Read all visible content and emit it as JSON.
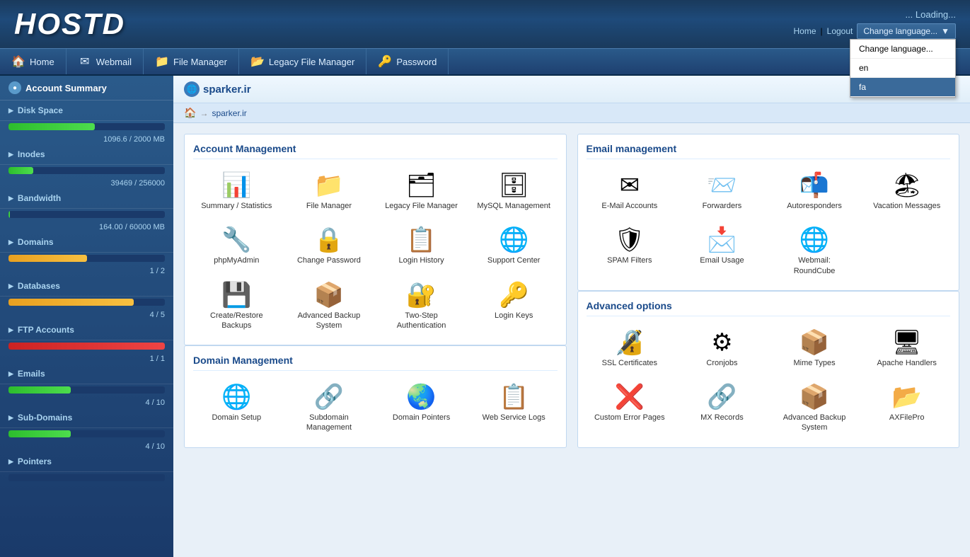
{
  "header": {
    "logo": "HOSTD",
    "loading": "... Loading...",
    "links": {
      "home": "Home",
      "pipe": "|",
      "logout": "Logout"
    },
    "language": {
      "button_label": "Change language...",
      "options": [
        {
          "value": "default",
          "label": "Change language..."
        },
        {
          "value": "en",
          "label": "en"
        },
        {
          "value": "fa",
          "label": "fa"
        }
      ]
    }
  },
  "navbar": {
    "items": [
      {
        "label": "Home",
        "icon": "🏠"
      },
      {
        "label": "Webmail",
        "icon": "✉"
      },
      {
        "label": "File Manager",
        "icon": "📁"
      },
      {
        "label": "Legacy File Manager",
        "icon": "📂"
      },
      {
        "label": "Password",
        "icon": "🔑"
      }
    ]
  },
  "sidebar": {
    "account_summary_label": "Account Summary",
    "sections": [
      {
        "label": "Disk Space",
        "value": "1096.6 / 2000 MB",
        "percent": 55,
        "color": "green"
      },
      {
        "label": "Inodes",
        "value": "39469 / 256000",
        "percent": 16,
        "color": "green"
      },
      {
        "label": "Bandwidth",
        "value": "164.00 / 60000 MB",
        "percent": 1,
        "color": "green"
      },
      {
        "label": "Domains",
        "value": "1 / 2",
        "percent": 50,
        "color": "orange"
      },
      {
        "label": "Databases",
        "value": "4 / 5",
        "percent": 80,
        "color": "orange"
      },
      {
        "label": "FTP Accounts",
        "value": "1 / 1",
        "percent": 100,
        "color": "red"
      },
      {
        "label": "Emails",
        "value": "4 / 10",
        "percent": 40,
        "color": "green"
      },
      {
        "label": "Sub-Domains",
        "value": "4 / 10",
        "percent": 40,
        "color": "green"
      },
      {
        "label": "Pointers",
        "value": "",
        "percent": 0,
        "color": "green"
      }
    ]
  },
  "breadcrumb": {
    "domain": "sparker.ir",
    "link": "sparker.ir"
  },
  "account_management": {
    "title": "Account Management",
    "items": [
      {
        "label": "Summary / Statistics",
        "emoji": "📊"
      },
      {
        "label": "File Manager",
        "emoji": "📁"
      },
      {
        "label": "Legacy File Manager",
        "emoji": "🗂"
      },
      {
        "label": "MySQL Management",
        "emoji": "🗄"
      },
      {
        "label": "phpMyAdmin",
        "emoji": "🔧"
      },
      {
        "label": "Change Password",
        "emoji": "🔒"
      },
      {
        "label": "Login History",
        "emoji": "📋"
      },
      {
        "label": "Support Center",
        "emoji": "🌐"
      },
      {
        "label": "Create/Restore Backups",
        "emoji": "💾"
      },
      {
        "label": "Advanced Backup System",
        "emoji": "📦"
      },
      {
        "label": "Two-Step Authentication",
        "emoji": "🔐"
      },
      {
        "label": "Login Keys",
        "emoji": "🔑"
      }
    ]
  },
  "email_management": {
    "title": "Email management",
    "items": [
      {
        "label": "E-Mail Accounts",
        "emoji": "✉"
      },
      {
        "label": "Forwarders",
        "emoji": "📨"
      },
      {
        "label": "Autoresponders",
        "emoji": "📬"
      },
      {
        "label": "Vacation Messages",
        "emoji": "🏖"
      },
      {
        "label": "SPAM Filters",
        "emoji": "🛡"
      },
      {
        "label": "Email Usage",
        "emoji": "📩"
      },
      {
        "label": "Webmail: RoundCube",
        "emoji": "🌐"
      }
    ]
  },
  "advanced_options": {
    "title": "Advanced options",
    "items": [
      {
        "label": "SSL Certificates",
        "emoji": "🔏"
      },
      {
        "label": "Cronjobs",
        "emoji": "⚙"
      },
      {
        "label": "Mime Types",
        "emoji": "📦"
      },
      {
        "label": "Apache Handlers",
        "emoji": "🖥"
      },
      {
        "label": "Custom Error Pages",
        "emoji": "❌"
      },
      {
        "label": "MX Records",
        "emoji": "🔗"
      },
      {
        "label": "Advanced Backup System",
        "emoji": "📦"
      },
      {
        "label": "AXFilePro",
        "emoji": "📂"
      }
    ]
  },
  "domain_management": {
    "title": "Domain Management",
    "items": [
      {
        "label": "Domain Setup",
        "emoji": "🌐"
      },
      {
        "label": "Subdomain Management",
        "emoji": "🔗"
      },
      {
        "label": "Domain Pointers",
        "emoji": "🌏"
      },
      {
        "label": "Web Service Logs",
        "emoji": "📋"
      }
    ]
  }
}
